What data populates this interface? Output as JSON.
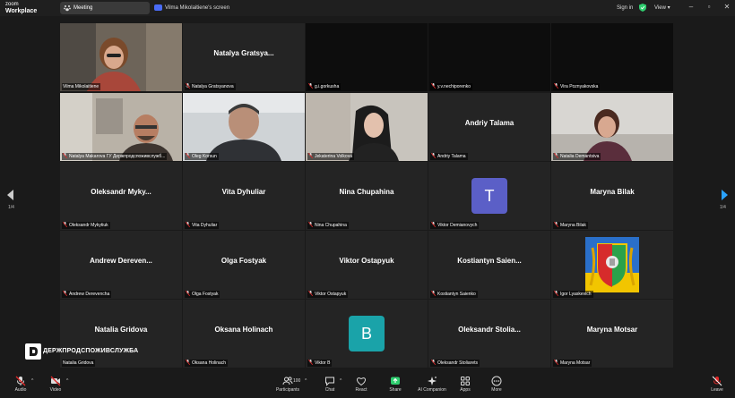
{
  "app": {
    "logo_top": "zoom",
    "logo_bottom": "Workplace"
  },
  "titlebar": {
    "meeting_tab": "Meeting",
    "screen_tab": "Vilma Mikolaitiene's screen",
    "sign_in": "Sign in",
    "view": "View"
  },
  "tiles": [
    {
      "label": "Vilma Mikolaitiene",
      "big": "",
      "type": "video"
    },
    {
      "label": "Natalya Gratsyanova",
      "big": "Natalya Gratsya...",
      "type": "name"
    },
    {
      "label": "g.i.gorkusha",
      "big": "",
      "type": "dark"
    },
    {
      "label": "y.v.nechiporenko",
      "big": "",
      "type": "dark"
    },
    {
      "label": "Vira Poznyakovska",
      "big": "",
      "type": "dark"
    },
    {
      "label": "Natalya Makarova ГУ Держпродспоживслужб...",
      "big": "",
      "type": "video"
    },
    {
      "label": "Oleg Korsun",
      "big": "",
      "type": "video"
    },
    {
      "label": "Jekaterina Volkova",
      "big": "",
      "type": "video"
    },
    {
      "label": "Andriy Talama",
      "big": "Andriy Talama",
      "type": "name"
    },
    {
      "label": "Natalia Demantsiva",
      "big": "",
      "type": "video"
    },
    {
      "label": "Oleksandr Mykytiuk",
      "big": "Oleksandr  Myky...",
      "type": "name"
    },
    {
      "label": "Vita Dyhuliar",
      "big": "Vita Dyhuliar",
      "type": "name"
    },
    {
      "label": "Nina Chupahina",
      "big": "Nina Chupahina",
      "type": "name"
    },
    {
      "label": "Viktor Demianovych",
      "big": "",
      "type": "avatar",
      "letter": "T"
    },
    {
      "label": "Maryna Bilak",
      "big": "Maryna Bilak",
      "type": "name"
    },
    {
      "label": "Andrew Derevencha",
      "big": "Andrew  Dereven...",
      "type": "name"
    },
    {
      "label": "Olga Fostyak",
      "big": "Olga Fostyak",
      "type": "name"
    },
    {
      "label": "Viktor Ostapyuk",
      "big": "Viktor Ostapyuk",
      "type": "name"
    },
    {
      "label": "Kostiantyn Saienko",
      "big": "Kostiantyn  Saien...",
      "type": "name"
    },
    {
      "label": "Igor Lyaskevich",
      "big": "",
      "type": "emblem"
    },
    {
      "label": "Natalia Gridova",
      "big": "Natalia Gridova",
      "type": "name"
    },
    {
      "label": "Oksana Holinach",
      "big": "Oksana Holinach",
      "type": "name"
    },
    {
      "label": "Viktor B",
      "big": "",
      "type": "avatar",
      "letter": "B"
    },
    {
      "label": "Oleksandr Stoliarets",
      "big": "Oleksandr  Stolia...",
      "type": "name"
    },
    {
      "label": "Maryna Motsar",
      "big": "Maryna Motsar",
      "type": "name"
    }
  ],
  "paging": {
    "left": "1/4",
    "right": "1/4"
  },
  "watermark": {
    "text": "ДЕРЖПРОДСПОЖИВСЛУЖБА"
  },
  "toolbar": {
    "audio": "Audio",
    "video": "Video",
    "participants": "Participants",
    "participants_count": "100",
    "chat": "Chat",
    "react": "React",
    "share": "Share",
    "ai": "AI Companion",
    "apps": "Apps",
    "more": "More",
    "leave": "Leave"
  },
  "colors": {
    "accent": "#2fce6f",
    "avatar_t": "#5b5fc7",
    "avatar_b": "#1aa3a9",
    "leave": "#e02828",
    "share": "#2fce6f"
  },
  "icons": [
    "shield-icon",
    "mic-muted-icon",
    "video-muted-icon",
    "participants-icon",
    "chat-icon",
    "react-icon",
    "share-icon",
    "ai-companion-icon",
    "apps-icon",
    "more-icon",
    "leave-icon"
  ]
}
